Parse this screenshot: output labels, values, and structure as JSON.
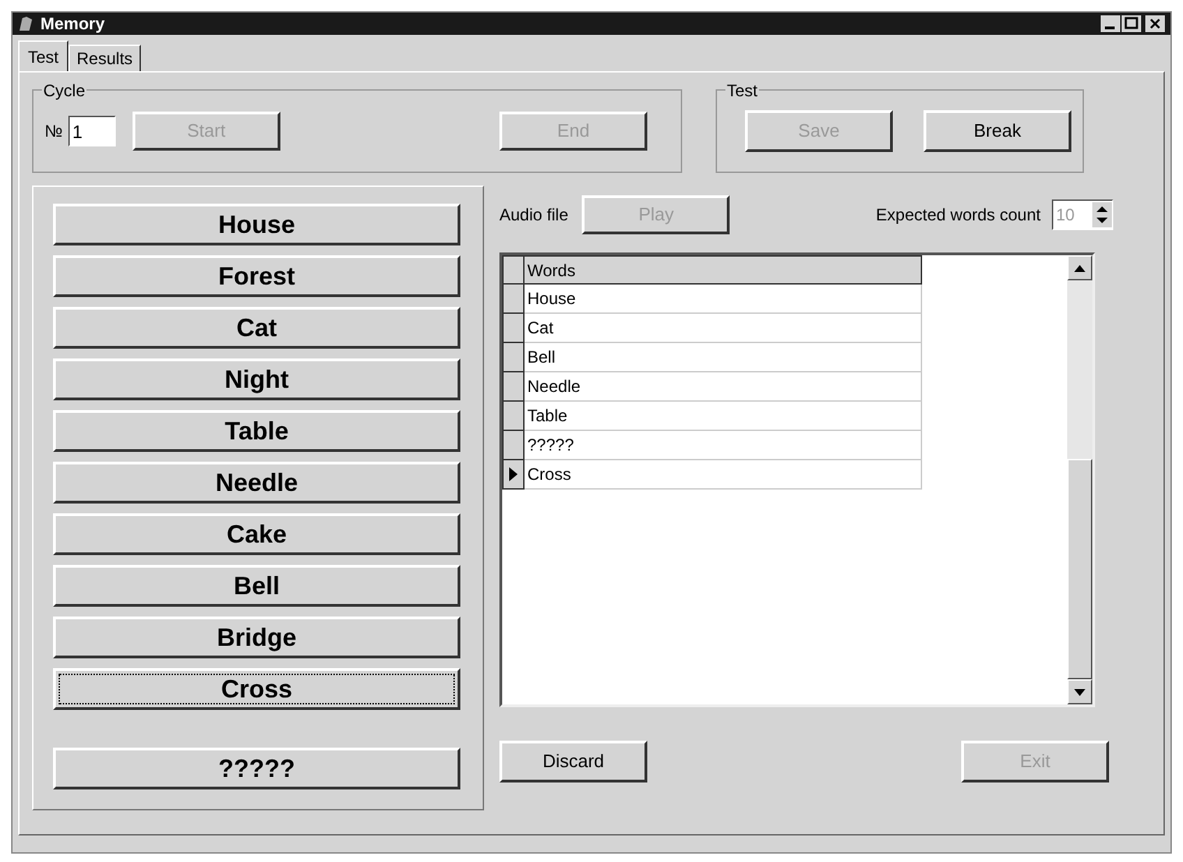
{
  "window": {
    "title": "Memory"
  },
  "tabs": [
    {
      "label": "Test",
      "selected": true
    },
    {
      "label": "Results",
      "selected": false
    }
  ],
  "cycle_group": {
    "title": "Cycle",
    "number_label": "№",
    "number_value": "1",
    "buttons": [
      {
        "label": "Start",
        "disabled": true
      },
      {
        "label": "End",
        "disabled": true
      }
    ]
  },
  "test_group": {
    "title": "Test",
    "buttons": [
      {
        "label": "Save",
        "disabled": true
      },
      {
        "label": "Break",
        "disabled": false
      }
    ]
  },
  "word_buttons": [
    {
      "label": "House",
      "focused": false
    },
    {
      "label": "Forest",
      "focused": false
    },
    {
      "label": "Cat",
      "focused": false
    },
    {
      "label": "Night",
      "focused": false
    },
    {
      "label": "Table",
      "focused": false
    },
    {
      "label": "Needle",
      "focused": false
    },
    {
      "label": "Cake",
      "focused": false
    },
    {
      "label": "Bell",
      "focused": false
    },
    {
      "label": "Bridge",
      "focused": false
    },
    {
      "label": "Cross",
      "focused": true
    },
    {
      "label": "?????",
      "focused": false
    }
  ],
  "audio": {
    "label": "Audio file",
    "button": {
      "label": "Play",
      "disabled": true
    }
  },
  "expected_count": {
    "label": "Expected words count",
    "value": "10"
  },
  "grid": {
    "column": "Words",
    "rows": [
      {
        "word": "House",
        "current": false
      },
      {
        "word": "Cat",
        "current": false
      },
      {
        "word": "Bell",
        "current": false
      },
      {
        "word": "Needle",
        "current": false
      },
      {
        "word": "Table",
        "current": false
      },
      {
        "word": "?????",
        "current": false
      },
      {
        "word": "Cross",
        "current": true
      }
    ]
  },
  "bottom_buttons": [
    {
      "label": "Discard",
      "disabled": false
    },
    {
      "label": "Exit",
      "disabled": true
    }
  ]
}
